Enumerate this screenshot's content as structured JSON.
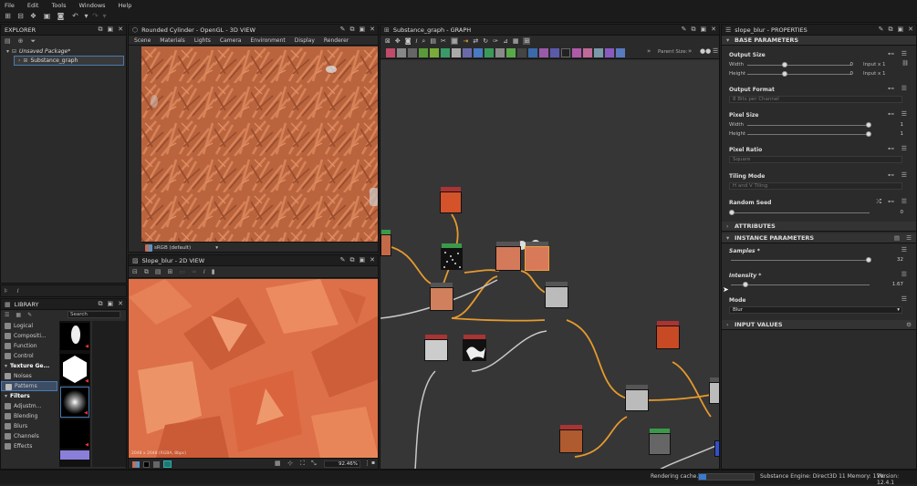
{
  "menu": [
    "File",
    "Edit",
    "Tools",
    "Windows",
    "Help"
  ],
  "explorer": {
    "title": "EXPLORER",
    "package": "Unsaved Package*",
    "graph": "Substance_graph"
  },
  "view3d": {
    "title": "Rounded Cylinder - OpenGL - 3D VIEW",
    "menus": [
      "Scene",
      "Materials",
      "Lights",
      "Camera",
      "Environment",
      "Display",
      "Renderer"
    ],
    "colorspace": "sRGB (default)"
  },
  "view2d": {
    "title": "Slope_blur - 2D VIEW",
    "info": "2048 x 2048 (RGBA, 8bpc)",
    "zoom": "92.46%"
  },
  "graph": {
    "title": "Substance_graph - GRAPH",
    "parent_size": "Parent Size:"
  },
  "library": {
    "title": "LIBRARY",
    "search": "Search",
    "items": [
      {
        "label": "Logical",
        "cat": false
      },
      {
        "label": "Compositi...",
        "cat": false
      },
      {
        "label": "Function",
        "cat": false
      },
      {
        "label": "Control",
        "cat": false
      },
      {
        "label": "Texture Ge...",
        "cat": true
      },
      {
        "label": "Noises",
        "cat": false
      },
      {
        "label": "Patterns",
        "cat": false
      },
      {
        "label": "Filters",
        "cat": true
      },
      {
        "label": "Adjustm...",
        "cat": false
      },
      {
        "label": "Blending",
        "cat": false
      },
      {
        "label": "Blurs",
        "cat": false
      },
      {
        "label": "Channels",
        "cat": false
      },
      {
        "label": "Effects",
        "cat": false
      }
    ]
  },
  "properties": {
    "title": "slope_blur - PROPERTIES",
    "base": "BASE PARAMETERS",
    "output_size": "Output Size",
    "width_label": "Width",
    "width_val": "0",
    "width_mode": "Input x 1",
    "height_label": "Height",
    "height_val": "0",
    "height_mode": "Input x 1",
    "output_format": "Output Format",
    "output_format_val": "8 Bits per Channel",
    "pixel_size": "Pixel Size",
    "ps_width": "Width",
    "ps_width_val": "1",
    "ps_height": "Height",
    "ps_height_val": "1",
    "pixel_ratio": "Pixel Ratio",
    "pixel_ratio_val": "Square",
    "tiling_mode": "Tiling Mode",
    "tiling_mode_val": "H and V Tiling",
    "random_seed": "Random Seed",
    "random_seed_val": "0",
    "attributes": "ATTRIBUTES",
    "instance": "INSTANCE PARAMETERS",
    "samples": "Samples *",
    "samples_val": "32",
    "intensity": "Intensity *",
    "intensity_val": "1.67",
    "mode": "Mode",
    "mode_val": "Blur",
    "input_values": "INPUT VALUES"
  },
  "status": {
    "rendering": "Rendering cache...",
    "engine": "Substance Engine: Direct3D 11  Memory: 17%",
    "version": "Version: 12.4.1"
  },
  "colors": {
    "accent": "#f0a030",
    "orange": "#e0623a",
    "panel": "#2b2b2b"
  }
}
